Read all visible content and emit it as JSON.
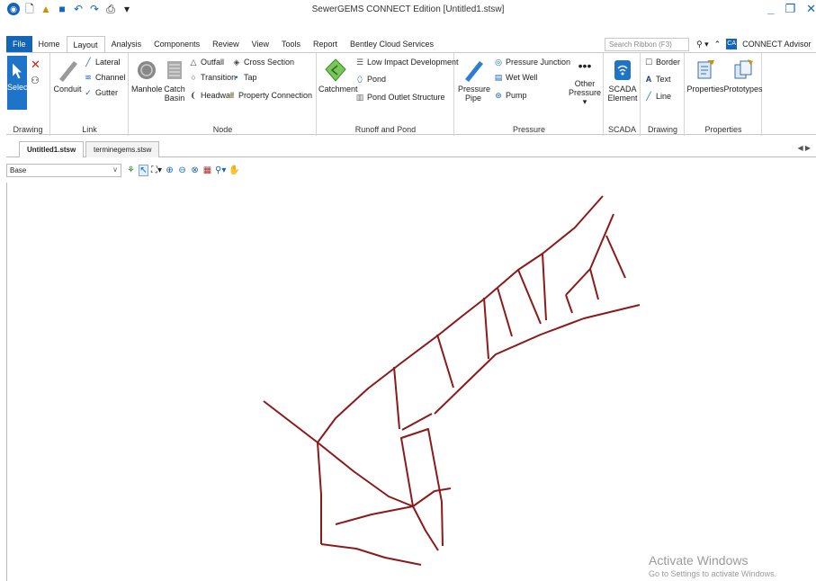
{
  "window": {
    "title": "SewerGEMS CONNECT Edition [Untitled1.stsw]"
  },
  "ribbon_tabs": [
    "File",
    "Home",
    "Layout",
    "Analysis",
    "Components",
    "Review",
    "View",
    "Tools",
    "Report",
    "Bentley Cloud Services"
  ],
  "active_tab": "Layout",
  "search": {
    "placeholder": "Search Ribbon (F3)"
  },
  "advisor_label": "CONNECT Advisor",
  "groups": {
    "drawing": {
      "label": "Drawing",
      "select": "Select"
    },
    "link": {
      "label": "Link",
      "conduit": "Conduit",
      "lateral": "Lateral",
      "channel": "Channel",
      "gutter": "Gutter"
    },
    "node": {
      "label": "Node",
      "manhole": "Manhole",
      "catch_basin_1": "Catch",
      "catch_basin_2": "Basin",
      "outfall": "Outfall",
      "transition": "Transition",
      "headwall": "Headwall",
      "cross_section": "Cross Section",
      "tap": "Tap",
      "property_connection": "Property Connection"
    },
    "runoff": {
      "label": "Runoff and Pond",
      "catchment": "Catchment",
      "lid": "Low Impact Development",
      "pond": "Pond",
      "pond_outlet": "Pond Outlet Structure"
    },
    "pressure": {
      "label": "Pressure",
      "pipe_1": "Pressure",
      "pipe_2": "Pipe",
      "junction": "Pressure Junction",
      "wet_well": "Wet Well",
      "pump": "Pump",
      "other_1": "Other",
      "other_2": "Pressure"
    },
    "scada": {
      "label": "SCADA",
      "element_1": "SCADA",
      "element_2": "Element"
    },
    "drawing2": {
      "label": "Drawing",
      "border": "Border",
      "text": "Text",
      "line": "Line"
    },
    "properties": {
      "label": "Properties",
      "properties": "Properties",
      "prototypes": "Prototypes"
    }
  },
  "doc_tabs": [
    "Untitled1.stsw",
    "terminegems.stsw"
  ],
  "active_doc": "Untitled1.stsw",
  "scenario": {
    "value": "Base"
  },
  "colors": {
    "accent": "#1464b8",
    "pipe": "#8b1a1a"
  },
  "watermark": {
    "line1": "Activate Windows",
    "line2": "Go to Settings to activate Windows."
  }
}
